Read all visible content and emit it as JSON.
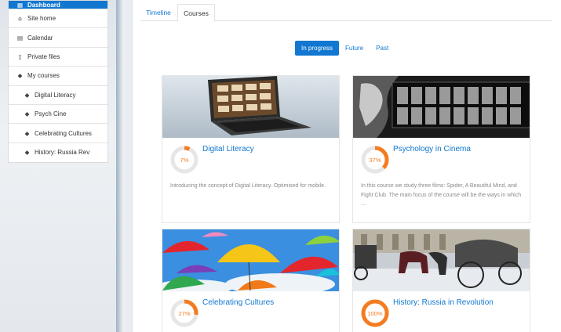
{
  "nav": {
    "items": [
      {
        "label": "Dashboard",
        "icon": "dashboard-icon",
        "active": true
      },
      {
        "label": "Site home",
        "icon": "home-icon"
      },
      {
        "label": "Calendar",
        "icon": "calendar-icon"
      },
      {
        "label": "Private files",
        "icon": "file-icon"
      },
      {
        "label": "My courses",
        "icon": "graduation-cap-icon"
      },
      {
        "label": "Digital Literacy",
        "icon": "graduation-cap-icon"
      },
      {
        "label": "Psych Cine",
        "icon": "graduation-cap-icon"
      },
      {
        "label": "Celebrating Cultures",
        "icon": "graduation-cap-icon"
      },
      {
        "label": "History: Russia Rev",
        "icon": "graduation-cap-icon"
      }
    ]
  },
  "tabs": {
    "timeline": "Timeline",
    "courses": "Courses"
  },
  "filters": {
    "in_progress": "In progress",
    "future": "Future",
    "past": "Past"
  },
  "courses": [
    {
      "title": "Digital Literacy",
      "progress_label": "7%",
      "progress_value": 7,
      "summary": "Introducing the concept of Digital Literacy. Optimised for mobile."
    },
    {
      "title": "Psychology in Cinema",
      "progress_label": "37%",
      "progress_value": 37,
      "summary": "In this course we study three films: Spider, A Beautiful Mind, and Fight Club. The main focus of the course will be the ways in which ..."
    },
    {
      "title": "Celebrating Cultures",
      "progress_label": "27%",
      "progress_value": 27,
      "summary": ""
    },
    {
      "title": "History: Russia in Revolution",
      "progress_label": "100%",
      "progress_value": 100,
      "summary": ""
    }
  ],
  "colors": {
    "accent": "#1177d1",
    "progress": "#f47c20",
    "progress_track": "#e6e6e6"
  }
}
